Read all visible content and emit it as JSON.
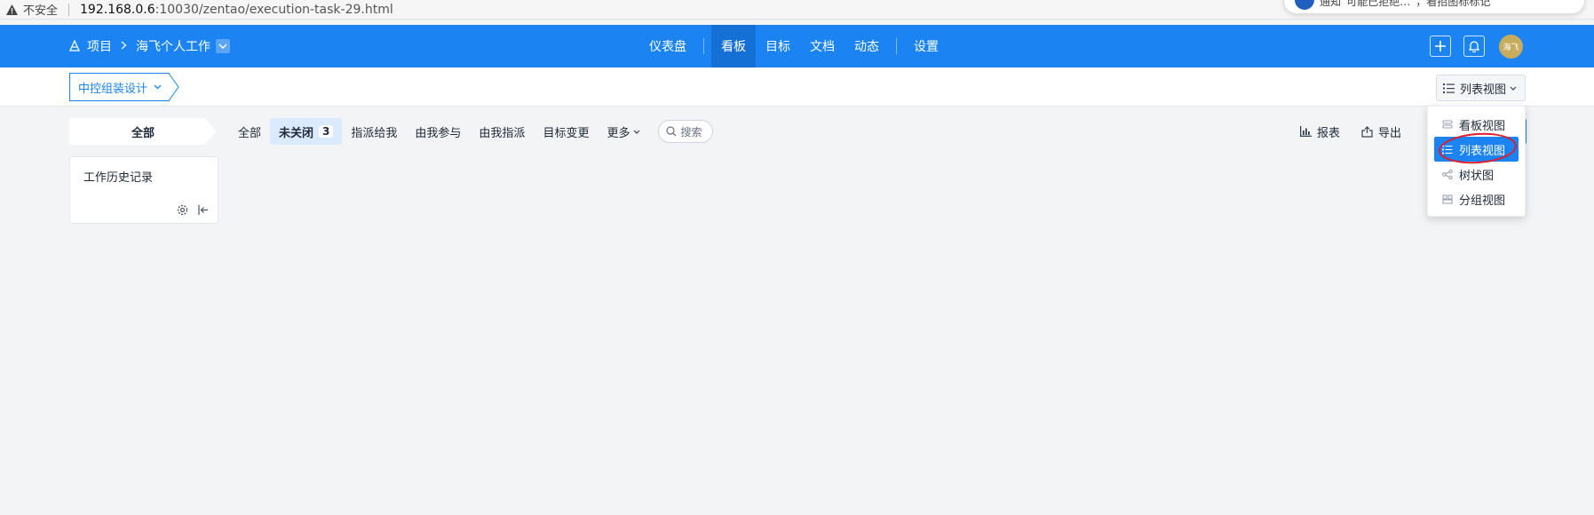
{
  "browser": {
    "insecure_label": "不安全",
    "url_host": "192.168.0.6",
    "url_path": ":10030/zentao/execution-task-29.html",
    "notification_text": "通知“可能已拒绝…”，看招图标标记"
  },
  "nav": {
    "breadcrumb_root": "项目",
    "breadcrumb_project": "海飞个人工作",
    "items": [
      {
        "label": "仪表盘"
      },
      {
        "label": "看板"
      },
      {
        "label": "目标"
      },
      {
        "label": "文档"
      },
      {
        "label": "动态"
      },
      {
        "label": "设置"
      }
    ],
    "active_item": "看板",
    "avatar_text": "海飞",
    "accent_color": "#1b84f2"
  },
  "subbar": {
    "execution_name": "中控组装设计",
    "view_button_label": "列表视图"
  },
  "filters": {
    "side_tab": "全部",
    "items": [
      {
        "label": "全部"
      },
      {
        "label": "未关闭",
        "count": "3"
      },
      {
        "label": "指派给我"
      },
      {
        "label": "由我参与"
      },
      {
        "label": "由我指派"
      },
      {
        "label": "目标变更"
      },
      {
        "label": "更多"
      }
    ],
    "search_placeholder": "搜索",
    "report_label": "报表",
    "export_label": "导出"
  },
  "card": {
    "title": "工作历史记录"
  },
  "view_menu": {
    "items": [
      {
        "label": "看板视图",
        "icon": "kanban-icon"
      },
      {
        "label": "列表视图",
        "icon": "list-icon"
      },
      {
        "label": "树状图",
        "icon": "tree-icon"
      },
      {
        "label": "分组视图",
        "icon": "group-icon"
      }
    ],
    "selected": "列表视图"
  }
}
